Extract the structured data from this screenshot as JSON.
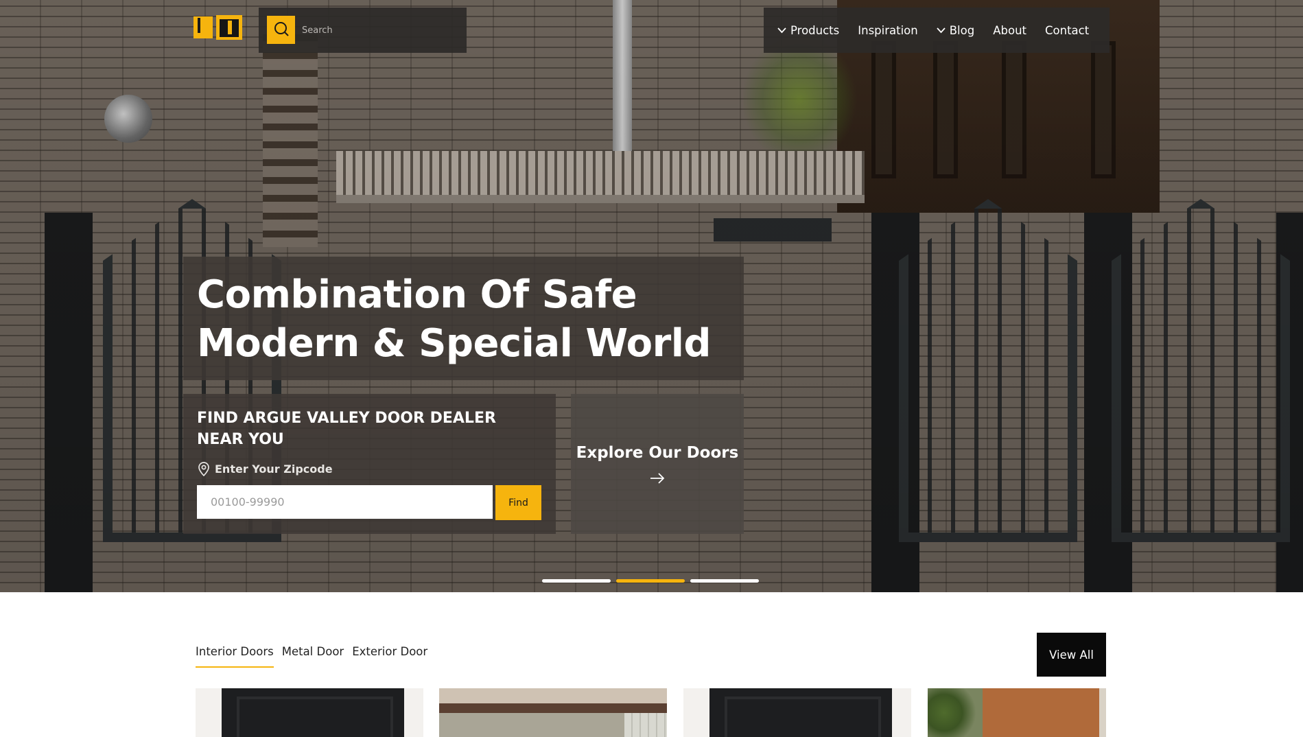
{
  "header": {
    "search": {
      "placeholder": "Search"
    },
    "nav": [
      {
        "label": "Products",
        "has_dropdown": true
      },
      {
        "label": "Inspiration",
        "has_dropdown": false
      },
      {
        "label": "Blog",
        "has_dropdown": true
      },
      {
        "label": "About",
        "has_dropdown": false
      },
      {
        "label": "Contact",
        "has_dropdown": false
      }
    ]
  },
  "hero": {
    "headline_line1": "Combination Of Safe",
    "headline_line2": "Modern & Special World",
    "dealer": {
      "title": "FIND ARGUE VALLEY DOOR DEALER NEAR YOU",
      "zip_label": "Enter Your Zipcode",
      "zip_placeholder": "00100-99990",
      "find_label": "Find"
    },
    "explore": {
      "title": "Explore Our Doors"
    },
    "slider": {
      "count": 3,
      "active_index": 1
    }
  },
  "products": {
    "tabs": [
      {
        "label": "Interior Doors",
        "active": true
      },
      {
        "label": "Metal Door",
        "active": false
      },
      {
        "label": "Exterior Door",
        "active": false
      }
    ],
    "view_all_label": "View All"
  },
  "colors": {
    "accent": "#f6b40e",
    "panel": "#3e3834",
    "dark_button": "#0a0a0a"
  },
  "icons": {
    "search": "search-icon",
    "dropdown": "chevron-down-icon",
    "location": "location-pin-icon",
    "arrow": "arrow-right-icon"
  }
}
